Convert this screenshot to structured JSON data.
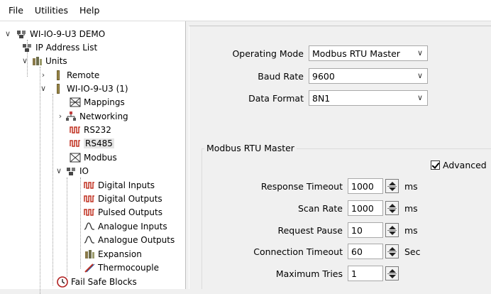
{
  "menu": {
    "file": "File",
    "utilities": "Utilities",
    "help": "Help"
  },
  "tree": {
    "root": "WI-IO-9-U3 DEMO",
    "ip_list": "IP Address List",
    "units": "Units",
    "remote": "Remote",
    "unit1": "WI-IO-9-U3 (1)",
    "mappings": "Mappings",
    "networking": "Networking",
    "rs232": "RS232",
    "rs485": "RS485",
    "modbus": "Modbus",
    "io": "IO",
    "digital_inputs": "Digital Inputs",
    "digital_outputs": "Digital Outputs",
    "pulsed_outputs": "Pulsed Outputs",
    "analogue_inputs": "Analogue Inputs",
    "analogue_outputs": "Analogue Outputs",
    "expansion": "Expansion",
    "thermocouple": "Thermocouple",
    "fail_safe": "Fail Safe Blocks"
  },
  "settings": {
    "operating_mode_label": "Operating Mode",
    "operating_mode_value": "Modbus RTU Master",
    "baud_rate_label": "Baud Rate",
    "baud_rate_value": "9600",
    "data_format_label": "Data Format",
    "data_format_value": "8N1"
  },
  "group": {
    "title": "Modbus RTU Master",
    "advanced_label": "Advanced",
    "advanced_checked": true,
    "response_timeout_label": "Response Timeout",
    "response_timeout_value": "1000",
    "response_timeout_unit": "ms",
    "scan_rate_label": "Scan Rate",
    "scan_rate_value": "1000",
    "scan_rate_unit": "ms",
    "request_pause_label": "Request Pause",
    "request_pause_value": "10",
    "request_pause_unit": "ms",
    "connection_timeout_label": "Connection Timeout",
    "connection_timeout_value": "60",
    "connection_timeout_unit": "Sec",
    "max_tries_label": "Maximum Tries",
    "max_tries_value": "1"
  }
}
